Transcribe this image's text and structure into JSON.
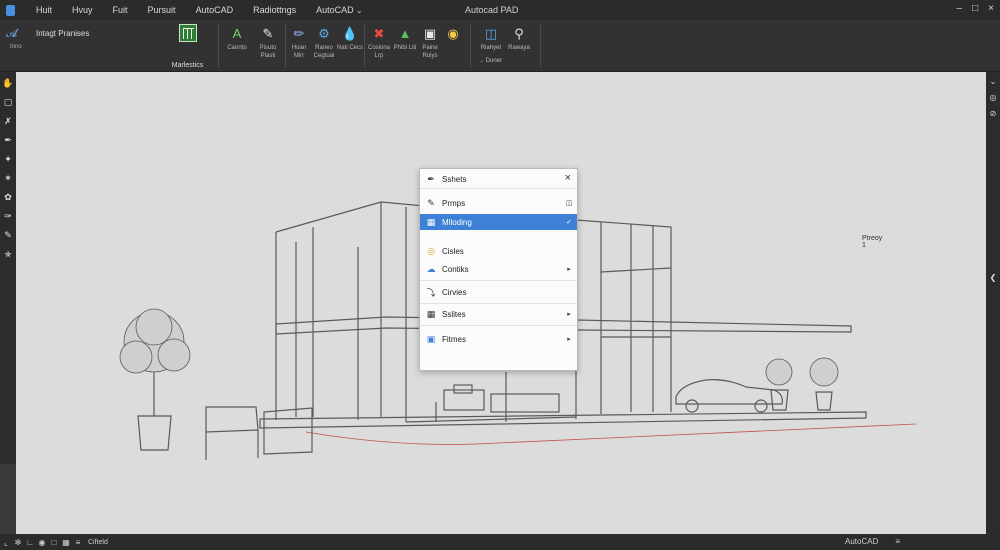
{
  "titlebar": {
    "menu": [
      "Huit",
      "Hvuy",
      "Fuit",
      "Pursuit",
      "AutoCAD",
      "Radiottngs",
      "AutoCAD"
    ],
    "title": "Autocad PAD"
  },
  "ribbon": {
    "left_title": "Intagt Pranises",
    "left_sub": "Inno",
    "big_button_label": "Marlestics",
    "tools": [
      {
        "icon": "text-A-icon",
        "label": "Cannto",
        "color": "#6fd06f"
      },
      {
        "icon": "pen-icon",
        "label": "Pisuto Plasti",
        "color": "#e8e8e8"
      },
      {
        "icon": "pencil-blue-icon",
        "label": "Hoan Mirr",
        "color": "#8fb8ff"
      },
      {
        "icon": "gear-blue-icon",
        "label": "Raneo Cegtuai",
        "color": "#5aa9e6"
      },
      {
        "icon": "drop-icon",
        "label": "Nati Cecs",
        "color": "#e0e0e0"
      },
      {
        "icon": "brush-color-icon",
        "label": "Cosiona Lrp",
        "color": "#e84b3c"
      },
      {
        "icon": "tree-icon",
        "label": "Phibi Liti",
        "color": "#5cc05c"
      },
      {
        "icon": "picture-icon",
        "label": "Paine Ruiys",
        "color": "#e8e8e8"
      },
      {
        "icon": "palette-icon",
        "label": "",
        "color": "#f2c94c"
      },
      {
        "icon": "screen-icon",
        "label": "Riahyet",
        "color": "#5aa9e6"
      },
      {
        "icon": "search-icon",
        "label": "Rawaya",
        "color": "#e0e0e0"
      }
    ],
    "bottom_row": "→ Duner"
  },
  "context_menu": {
    "head": "Sshets",
    "rows": [
      {
        "label": "Prmps",
        "icon": "panel-icon"
      },
      {
        "label": "Mlloding",
        "icon": "layout-icon"
      },
      {
        "label": "Cisles",
        "icon": "circles-icon"
      },
      {
        "label": "Contiks",
        "icon": "cloud-icon"
      },
      {
        "label": "Cirvies",
        "icon": "curve-icon"
      },
      {
        "label": "Sslites",
        "icon": "grid-icon"
      },
      {
        "label": "Fitmes",
        "icon": "frame-icon"
      }
    ],
    "sub_label": "Ptreoy 1"
  },
  "status": {
    "model": "Cifteld",
    "app": "AutoCAD"
  },
  "colors": {
    "highlight": "#3d80d6",
    "canvas": "#dcdcdc",
    "chrome": "#2b2b2b"
  }
}
